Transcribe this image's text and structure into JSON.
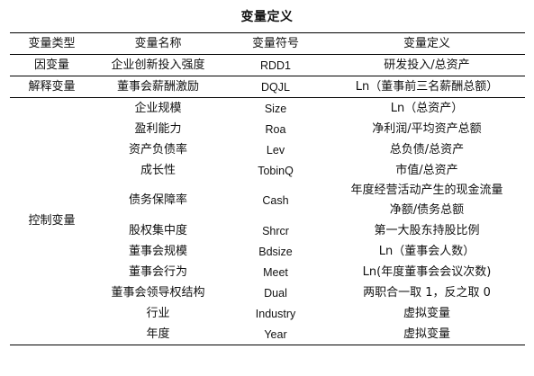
{
  "title": "变量定义",
  "headers": [
    "变量类型",
    "变量名称",
    "变量符号",
    "变量定义"
  ],
  "rows": {
    "dependent": {
      "type": "因变量",
      "name": "企业创新投入强度",
      "symbol": "RDD1",
      "definition": "研发投入/总资产"
    },
    "explanatory": {
      "type": "解释变量",
      "name": "董事会薪酬激励",
      "symbol": "DQJL",
      "definition": "Ln（董事前三名薪酬总额）"
    },
    "control_type": "控制变量",
    "controls": [
      {
        "name": "企业规模",
        "symbol": "Size",
        "definition": "Ln（总资产）"
      },
      {
        "name": "盈利能力",
        "symbol": "Roa",
        "definition": "净利润/平均资产总额"
      },
      {
        "name": "资产负债率",
        "symbol": "Lev",
        "definition": "总负债/总资产"
      },
      {
        "name": "成长性",
        "symbol": "TobinQ",
        "definition": "市值/总资产"
      },
      {
        "name": "债务保障率",
        "symbol": "Cash",
        "definition_line1": "年度经营活动产生的现金流量",
        "definition_line2": "净额/债务总额"
      },
      {
        "name": "股权集中度",
        "symbol": "Shrcr",
        "definition": "第一大股东持股比例"
      },
      {
        "name": "董事会规模",
        "symbol": "Bdsize",
        "definition": "Ln（董事会人数）"
      },
      {
        "name": "董事会行为",
        "symbol": "Meet",
        "definition": "Ln(年度董事会会议次数)"
      },
      {
        "name": "董事会领导权结构",
        "symbol": "Dual",
        "definition": "两职合一取 1，反之取 0"
      },
      {
        "name": "行业",
        "symbol": "Industry",
        "definition": "虚拟变量"
      },
      {
        "name": "年度",
        "symbol": "Year",
        "definition": "虚拟变量"
      }
    ]
  }
}
